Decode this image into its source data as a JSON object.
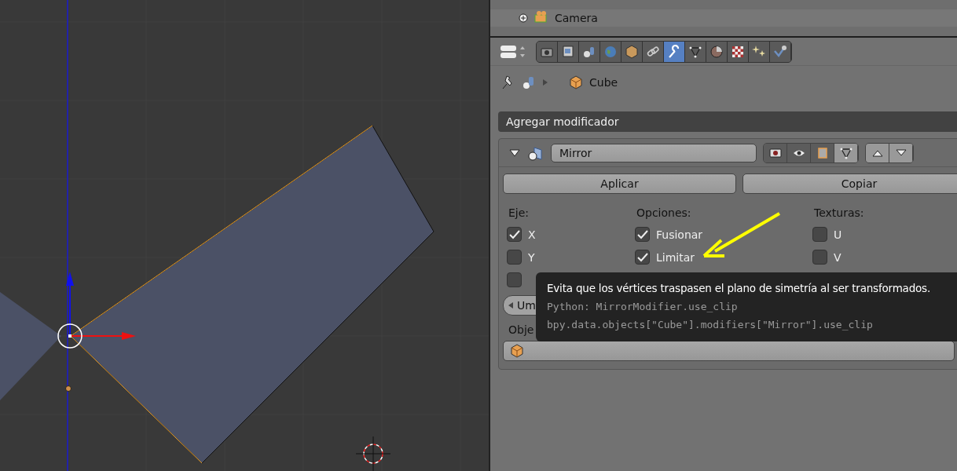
{
  "outliner": {
    "rows": [
      {
        "label": "Camera"
      }
    ]
  },
  "properties": {
    "tabs": [
      {
        "kind": "render",
        "selected": false
      },
      {
        "kind": "render-layers",
        "selected": false
      },
      {
        "kind": "scene",
        "selected": false
      },
      {
        "kind": "world",
        "selected": false
      },
      {
        "kind": "object",
        "selected": false
      },
      {
        "kind": "constraints",
        "selected": false
      },
      {
        "kind": "modifiers",
        "selected": true
      },
      {
        "kind": "data",
        "selected": false
      },
      {
        "kind": "material",
        "selected": false
      },
      {
        "kind": "texture",
        "selected": false
      },
      {
        "kind": "particles",
        "selected": false
      },
      {
        "kind": "physics",
        "selected": false
      }
    ],
    "breadcrumb": "Cube",
    "add_modifier": "Agregar modificador",
    "modifier": {
      "name": "Mirror",
      "expanded": true,
      "show_render": true,
      "show_viewport": true,
      "show_editmode": true,
      "show_cage": false,
      "buttons": [
        "Aplicar",
        "Copiar"
      ],
      "columns": [
        {
          "label": "Eje:",
          "items": [
            {
              "label": "X",
              "checked": true
            },
            {
              "label": "Y",
              "checked": false
            },
            {
              "checked": false
            }
          ]
        },
        {
          "label": "Opciones:",
          "items": [
            {
              "label": "Fusionar",
              "checked": true
            },
            {
              "label": "Limitar",
              "checked": true
            }
          ]
        },
        {
          "label": "Texturas:",
          "items": [
            {
              "label": "U",
              "checked": false
            },
            {
              "label": "V",
              "checked": false
            }
          ]
        }
      ],
      "merge": {
        "label": "Um"
      },
      "mirror_object": {
        "label": "Obje"
      }
    },
    "tooltip": {
      "text": "Evita que los vértices traspasen el plano de simetría al ser transformados.",
      "python": "Python: MirrorModifier.use_clip",
      "path": "bpy.data.objects[\"Cube\"].modifiers[\"Mirror\"].use_clip"
    }
  }
}
